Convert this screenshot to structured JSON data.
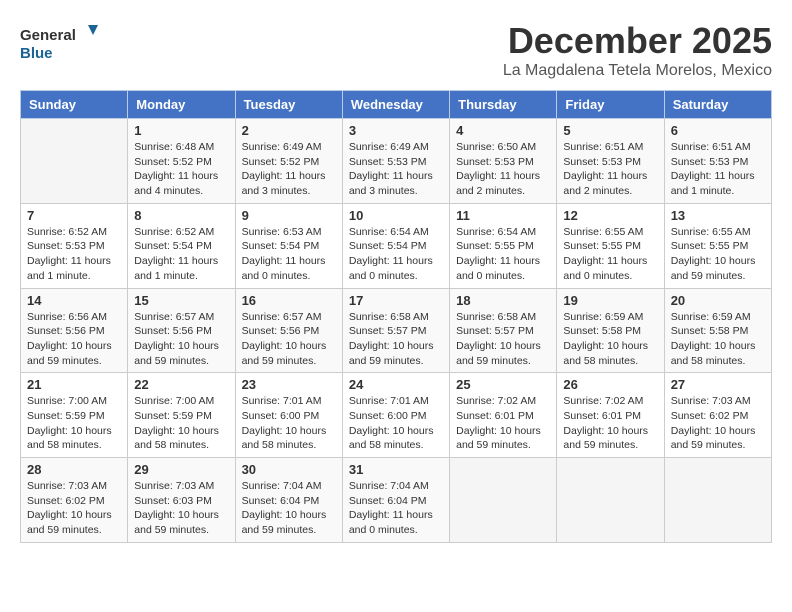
{
  "header": {
    "logo_line1": "General",
    "logo_line2": "Blue",
    "month": "December 2025",
    "location": "La Magdalena Tetela Morelos, Mexico"
  },
  "days_of_week": [
    "Sunday",
    "Monday",
    "Tuesday",
    "Wednesday",
    "Thursday",
    "Friday",
    "Saturday"
  ],
  "weeks": [
    [
      {
        "day": "",
        "info": ""
      },
      {
        "day": "1",
        "info": "Sunrise: 6:48 AM\nSunset: 5:52 PM\nDaylight: 11 hours\nand 4 minutes."
      },
      {
        "day": "2",
        "info": "Sunrise: 6:49 AM\nSunset: 5:52 PM\nDaylight: 11 hours\nand 3 minutes."
      },
      {
        "day": "3",
        "info": "Sunrise: 6:49 AM\nSunset: 5:53 PM\nDaylight: 11 hours\nand 3 minutes."
      },
      {
        "day": "4",
        "info": "Sunrise: 6:50 AM\nSunset: 5:53 PM\nDaylight: 11 hours\nand 2 minutes."
      },
      {
        "day": "5",
        "info": "Sunrise: 6:51 AM\nSunset: 5:53 PM\nDaylight: 11 hours\nand 2 minutes."
      },
      {
        "day": "6",
        "info": "Sunrise: 6:51 AM\nSunset: 5:53 PM\nDaylight: 11 hours\nand 1 minute."
      }
    ],
    [
      {
        "day": "7",
        "info": "Sunrise: 6:52 AM\nSunset: 5:53 PM\nDaylight: 11 hours\nand 1 minute."
      },
      {
        "day": "8",
        "info": "Sunrise: 6:52 AM\nSunset: 5:54 PM\nDaylight: 11 hours\nand 1 minute."
      },
      {
        "day": "9",
        "info": "Sunrise: 6:53 AM\nSunset: 5:54 PM\nDaylight: 11 hours\nand 0 minutes."
      },
      {
        "day": "10",
        "info": "Sunrise: 6:54 AM\nSunset: 5:54 PM\nDaylight: 11 hours\nand 0 minutes."
      },
      {
        "day": "11",
        "info": "Sunrise: 6:54 AM\nSunset: 5:55 PM\nDaylight: 11 hours\nand 0 minutes."
      },
      {
        "day": "12",
        "info": "Sunrise: 6:55 AM\nSunset: 5:55 PM\nDaylight: 11 hours\nand 0 minutes."
      },
      {
        "day": "13",
        "info": "Sunrise: 6:55 AM\nSunset: 5:55 PM\nDaylight: 10 hours\nand 59 minutes."
      }
    ],
    [
      {
        "day": "14",
        "info": "Sunrise: 6:56 AM\nSunset: 5:56 PM\nDaylight: 10 hours\nand 59 minutes."
      },
      {
        "day": "15",
        "info": "Sunrise: 6:57 AM\nSunset: 5:56 PM\nDaylight: 10 hours\nand 59 minutes."
      },
      {
        "day": "16",
        "info": "Sunrise: 6:57 AM\nSunset: 5:56 PM\nDaylight: 10 hours\nand 59 minutes."
      },
      {
        "day": "17",
        "info": "Sunrise: 6:58 AM\nSunset: 5:57 PM\nDaylight: 10 hours\nand 59 minutes."
      },
      {
        "day": "18",
        "info": "Sunrise: 6:58 AM\nSunset: 5:57 PM\nDaylight: 10 hours\nand 59 minutes."
      },
      {
        "day": "19",
        "info": "Sunrise: 6:59 AM\nSunset: 5:58 PM\nDaylight: 10 hours\nand 58 minutes."
      },
      {
        "day": "20",
        "info": "Sunrise: 6:59 AM\nSunset: 5:58 PM\nDaylight: 10 hours\nand 58 minutes."
      }
    ],
    [
      {
        "day": "21",
        "info": "Sunrise: 7:00 AM\nSunset: 5:59 PM\nDaylight: 10 hours\nand 58 minutes."
      },
      {
        "day": "22",
        "info": "Sunrise: 7:00 AM\nSunset: 5:59 PM\nDaylight: 10 hours\nand 58 minutes."
      },
      {
        "day": "23",
        "info": "Sunrise: 7:01 AM\nSunset: 6:00 PM\nDaylight: 10 hours\nand 58 minutes."
      },
      {
        "day": "24",
        "info": "Sunrise: 7:01 AM\nSunset: 6:00 PM\nDaylight: 10 hours\nand 58 minutes."
      },
      {
        "day": "25",
        "info": "Sunrise: 7:02 AM\nSunset: 6:01 PM\nDaylight: 10 hours\nand 59 minutes."
      },
      {
        "day": "26",
        "info": "Sunrise: 7:02 AM\nSunset: 6:01 PM\nDaylight: 10 hours\nand 59 minutes."
      },
      {
        "day": "27",
        "info": "Sunrise: 7:03 AM\nSunset: 6:02 PM\nDaylight: 10 hours\nand 59 minutes."
      }
    ],
    [
      {
        "day": "28",
        "info": "Sunrise: 7:03 AM\nSunset: 6:02 PM\nDaylight: 10 hours\nand 59 minutes."
      },
      {
        "day": "29",
        "info": "Sunrise: 7:03 AM\nSunset: 6:03 PM\nDaylight: 10 hours\nand 59 minutes."
      },
      {
        "day": "30",
        "info": "Sunrise: 7:04 AM\nSunset: 6:04 PM\nDaylight: 10 hours\nand 59 minutes."
      },
      {
        "day": "31",
        "info": "Sunrise: 7:04 AM\nSunset: 6:04 PM\nDaylight: 11 hours\nand 0 minutes."
      },
      {
        "day": "",
        "info": ""
      },
      {
        "day": "",
        "info": ""
      },
      {
        "day": "",
        "info": ""
      }
    ]
  ]
}
